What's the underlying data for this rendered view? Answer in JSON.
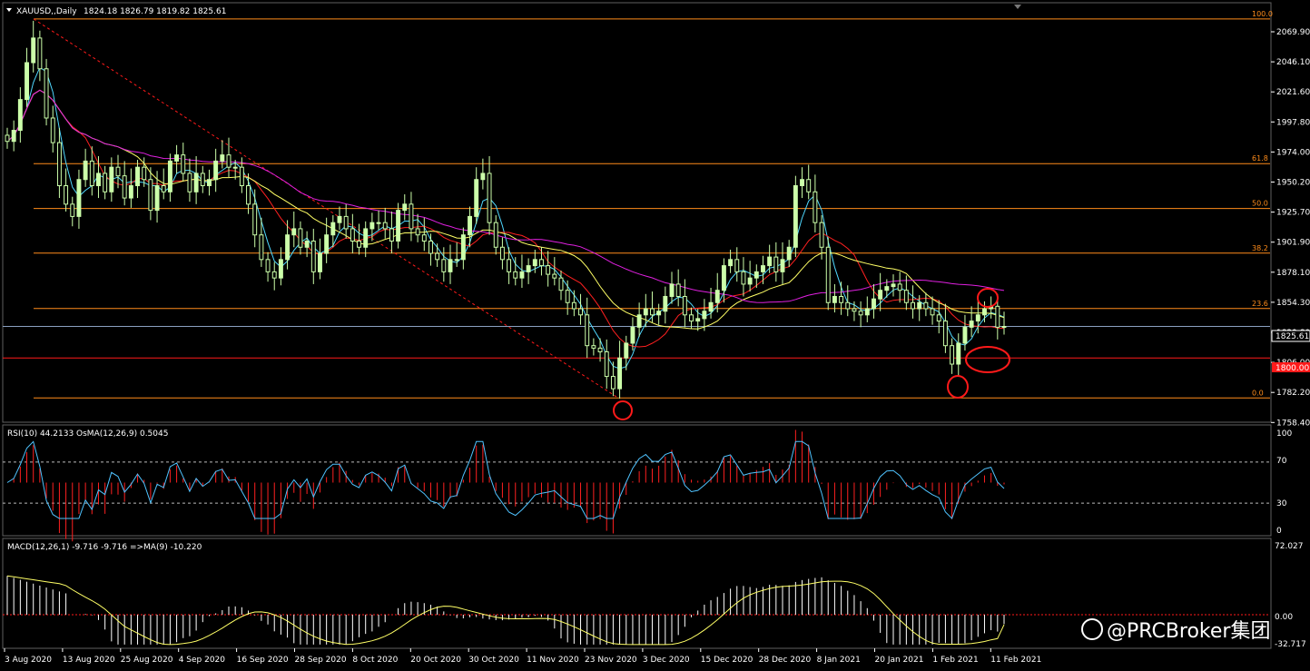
{
  "header": {
    "symbol": "XAUUSD,,Daily",
    "ohlc": "1824.18 1826.79 1819.82 1825.61"
  },
  "price_axis": {
    "ticks": [
      "2069.90",
      "2046.10",
      "2021.60",
      "1997.80",
      "1974.00",
      "1950.20",
      "1925.70",
      "1901.90",
      "1878.10",
      "1854.30",
      "1829.80",
      "1806.00",
      "1782.20",
      "1758.40"
    ],
    "current_price": "1825.61",
    "support_label": "1800.00"
  },
  "fib_levels": [
    {
      "label": "100.0",
      "price": 2075.5
    },
    {
      "label": "61.8",
      "price": 1957.9
    },
    {
      "label": "50.0",
      "price": 1921.5
    },
    {
      "label": "38.2",
      "price": 1885.2
    },
    {
      "label": "23.6",
      "price": 1840.2
    },
    {
      "label": "0.0",
      "price": 1767.5
    }
  ],
  "rsi_panel": {
    "title": "RSI(10) 44.2133  OsMA(12,26,9) 0.5045",
    "ticks": [
      "100",
      "70",
      "30",
      "0"
    ]
  },
  "macd_panel": {
    "title": "MACD(12,26,1) -9.716 -9.716  =>MA(9) -10.220",
    "ticks": [
      "72.027",
      "0.00",
      "-32.717"
    ]
  },
  "date_axis": [
    "3 Aug 2020",
    "13 Aug 2020",
    "25 Aug 2020",
    "4 Sep 2020",
    "16 Sep 2020",
    "28 Sep 2020",
    "8 Oct 2020",
    "20 Oct 2020",
    "30 Oct 2020",
    "11 Nov 2020",
    "23 Nov 2020",
    "3 Dec 2020",
    "15 Dec 2020",
    "28 Dec 2020",
    "8 Jan 2021",
    "20 Jan 2021",
    "1 Feb 2021",
    "11 Feb 2021"
  ],
  "watermark": "@PRCBroker集团",
  "colors": {
    "background": "#000000",
    "candle": "#ccffaa",
    "fib": "#ff8c1a",
    "ma_fast": "#4fd8ff",
    "ma_mid": "#ff2020",
    "ma_slow": "#ffff66",
    "ma_long": "#e020e0",
    "rsi": "#4fc3ff",
    "osma": "#ff2020",
    "macd_hist": "#ffffff",
    "macd_signal": "#ffff66",
    "highlight": "#ff1a1a"
  },
  "chart_data": {
    "type": "candlestick",
    "title": "XAUUSD,,Daily",
    "closes": [
      1976,
      1985,
      2010,
      2040,
      2060,
      2035,
      1995,
      1975,
      1940,
      1925,
      1915,
      1945,
      1960,
      1940,
      1950,
      1935,
      1955,
      1948,
      1930,
      1940,
      1955,
      1945,
      1920,
      1940,
      1935,
      1960,
      1965,
      1950,
      1935,
      1950,
      1940,
      1945,
      1960,
      1965,
      1955,
      1955,
      1940,
      1925,
      1900,
      1880,
      1870,
      1865,
      1880,
      1900,
      1905,
      1890,
      1895,
      1870,
      1885,
      1900,
      1910,
      1915,
      1905,
      1895,
      1890,
      1905,
      1910,
      1910,
      1905,
      1895,
      1920,
      1925,
      1905,
      1900,
      1895,
      1885,
      1880,
      1870,
      1880,
      1880,
      1900,
      1915,
      1945,
      1950,
      1910,
      1890,
      1880,
      1870,
      1865,
      1870,
      1875,
      1880,
      1875,
      1868,
      1865,
      1855,
      1845,
      1840,
      1835,
      1810,
      1808,
      1805,
      1785,
      1775,
      1800,
      1812,
      1825,
      1835,
      1840,
      1835,
      1838,
      1850,
      1860,
      1850,
      1835,
      1830,
      1832,
      1838,
      1845,
      1855,
      1875,
      1880,
      1870,
      1860,
      1865,
      1870,
      1875,
      1882,
      1870,
      1880,
      1890,
      1940,
      1945,
      1935,
      1910,
      1890,
      1845,
      1850,
      1845,
      1840,
      1838,
      1835,
      1840,
      1848,
      1855,
      1858,
      1860,
      1855,
      1845,
      1840,
      1845,
      1840,
      1835,
      1830,
      1810,
      1795,
      1812,
      1825,
      1830,
      1835,
      1840,
      1842,
      1825,
      1825.61
    ],
    "fib_levels": [
      {
        "label": "100.0",
        "price": 2075.5
      },
      {
        "label": "61.8",
        "price": 1957.9
      },
      {
        "label": "50.0",
        "price": 1921.5
      },
      {
        "label": "38.2",
        "price": 1885.2
      },
      {
        "label": "23.6",
        "price": 1840.2
      },
      {
        "label": "0.0",
        "price": 1767.5
      }
    ],
    "support_level": 1800.0,
    "current_price": 1825.61,
    "ylim": [
      1750,
      2085
    ],
    "rsi_value": 44.2133,
    "osma_value": 0.5045,
    "macd_value": -9.716,
    "macd_signal_value": -10.22,
    "rsi_ylim": [
      0,
      100
    ],
    "macd_ylim": [
      -32.717,
      72.027
    ]
  }
}
